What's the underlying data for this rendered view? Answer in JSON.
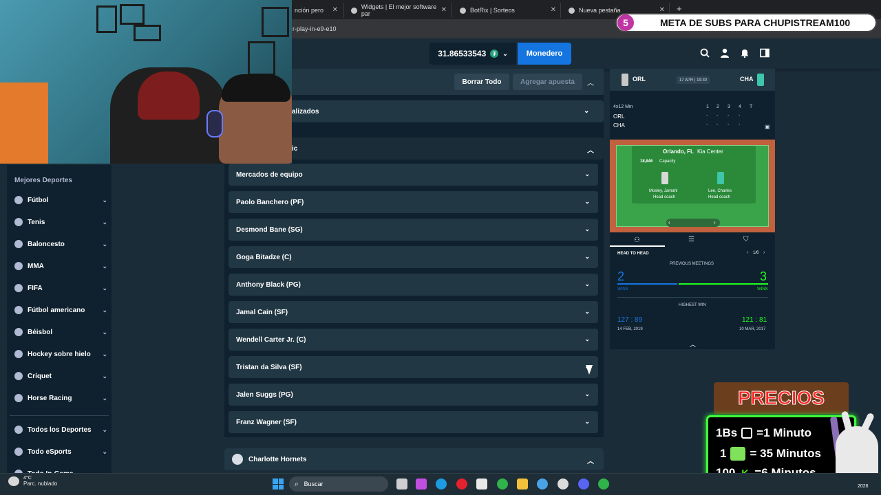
{
  "browser": {
    "tabs": [
      {
        "title": "nción pero"
      },
      {
        "title": "Widgets | El mejor software par"
      },
      {
        "title": "BotRix | Sorteos"
      },
      {
        "title": "Nueva pestaña"
      }
    ],
    "url": "r-play-in-e9-e10"
  },
  "header": {
    "balance": "31.86533543",
    "coin_symbol": "₮",
    "wallet_label": "Monedero"
  },
  "sidebar": {
    "heading": "Mejores Deportes",
    "items": [
      {
        "label": "Fútbol",
        "icon": "soccer-ball-icon"
      },
      {
        "label": "Tenis",
        "icon": "tennis-ball-icon"
      },
      {
        "label": "Baloncesto",
        "icon": "basketball-icon"
      },
      {
        "label": "MMA",
        "icon": "mma-glove-icon"
      },
      {
        "label": "FIFA",
        "icon": "fifa-icon"
      },
      {
        "label": "Fútbol americano",
        "icon": "american-football-icon"
      },
      {
        "label": "Béisbol",
        "icon": "baseball-icon"
      },
      {
        "label": "Hockey sobre hielo",
        "icon": "hockey-icon"
      },
      {
        "label": "Críquet",
        "icon": "cricket-icon"
      },
      {
        "label": "Horse Racing",
        "icon": "horse-icon"
      }
    ],
    "bottom_items": [
      {
        "label": "Todos los Deportes",
        "icon": "all-sports-icon"
      },
      {
        "label": "Todo eSports",
        "icon": "esports-icon"
      },
      {
        "label": "Todo In-Game",
        "icon": "in-game-icon"
      }
    ]
  },
  "betslip": {
    "clear_label": "Borrar Todo",
    "add_bet_label": "Agregar apuesta",
    "section1_label": "alizados",
    "section2_label": "ic",
    "markets": [
      "Mercados de equipo",
      "Paolo Banchero (PF)",
      "Desmond Bane (SG)",
      "Goga Bitadze (C)",
      "Anthony Black (PG)",
      "Jamal Cain (SF)",
      "Wendell Carter Jr. (C)",
      "Tristan da Silva (SF)",
      "Jalen Suggs (PG)",
      "Franz Wagner (SF)"
    ],
    "next_team": "Charlotte Hornets"
  },
  "match": {
    "home": "ORL",
    "away": "CHA",
    "date": "17 APR | 19:30",
    "period_label": "4x12 Min",
    "quarters": [
      "1",
      "2",
      "3",
      "4",
      "T"
    ],
    "score_home": [
      "-",
      "-",
      "-",
      "-"
    ],
    "score_away": [
      "-",
      "-",
      "-",
      "-"
    ],
    "venue_city": "Orlando, FL",
    "venue_name": "Kia Center",
    "capacity_value": "18,846",
    "capacity_label": "Capacity",
    "coach_home": "Mosley, Jamahl",
    "coach_away": "Lee, Charles",
    "coach_role": "Head coach",
    "h2h_title": "HEAD TO HEAD",
    "h2h_page": "1/6",
    "previous_meetings": "PREVIOUS MEETINGS",
    "wins_home": "2",
    "wins_away": "3",
    "wins_label": "WINS",
    "highest_win": "HIGHEST WIN",
    "hw_home_score": "127 : 89",
    "hw_home_date": "14 FEB, 2019",
    "hw_away_score": "121 : 81",
    "hw_away_date": "10 MAR, 2017",
    "colors": {
      "home": "#c8c8c8",
      "away": "#3ec6a8",
      "blue": "#1475e1",
      "green": "#1fff20"
    }
  },
  "overlay": {
    "banner_number": "5",
    "banner_text": "META DE SUBS PARA CHUPISTREAM100",
    "prices_title": "PRECIOS",
    "price_lines": [
      {
        "left": "1Bs",
        "right": "=1 Minuto",
        "icon": "qr-code-icon"
      },
      {
        "left": "1",
        "right": "= 35 Minutos",
        "icon": "gift-icon"
      },
      {
        "left": "100",
        "right": "=6 Minutos",
        "icon": "kick-logo-icon"
      }
    ]
  },
  "taskbar": {
    "temp": "4°C",
    "weather": "Parc. nublado",
    "search_label": "Buscar",
    "year": "2026"
  }
}
